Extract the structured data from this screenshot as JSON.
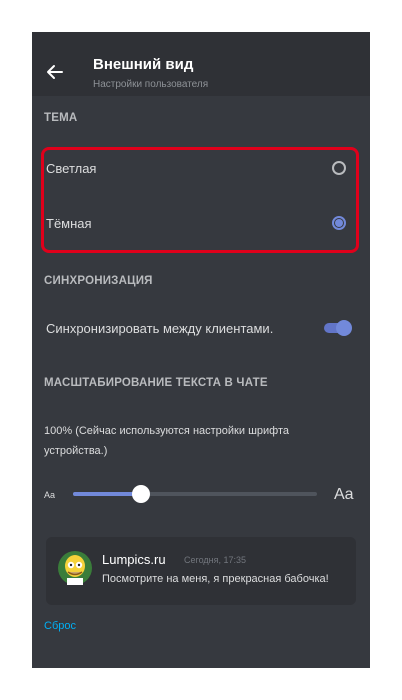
{
  "header": {
    "title": "Внешний вид",
    "subtitle": "Настройки пользователя"
  },
  "theme": {
    "section_label": "ТЕМА",
    "options": [
      {
        "label": "Светлая",
        "selected": false
      },
      {
        "label": "Тёмная",
        "selected": true
      }
    ]
  },
  "sync": {
    "section_label": "СИНХРОНИЗАЦИЯ",
    "toggle_label": "Синхронизировать между клиентами.",
    "toggle_on": true
  },
  "text_scale": {
    "section_label": "МАСШТАБИРОВАНИЕ ТЕКСТА В ЧАТЕ",
    "info": "100% (Сейчас используются настройки шрифта устройства.)",
    "small_label": "Aa",
    "large_label": "Aa",
    "slider_value_fraction": 0.28
  },
  "preview": {
    "author": "Lumpics.ru",
    "timestamp": "Сегодня, 17:35",
    "message": "Посмотрите на меня, я прекрасная бабочка!"
  },
  "reset_label": "Сброс",
  "colors": {
    "accent": "#7289da",
    "background": "#36393f",
    "header_bg": "#2f3136",
    "highlight": "#e0001b",
    "link": "#00aff4"
  }
}
